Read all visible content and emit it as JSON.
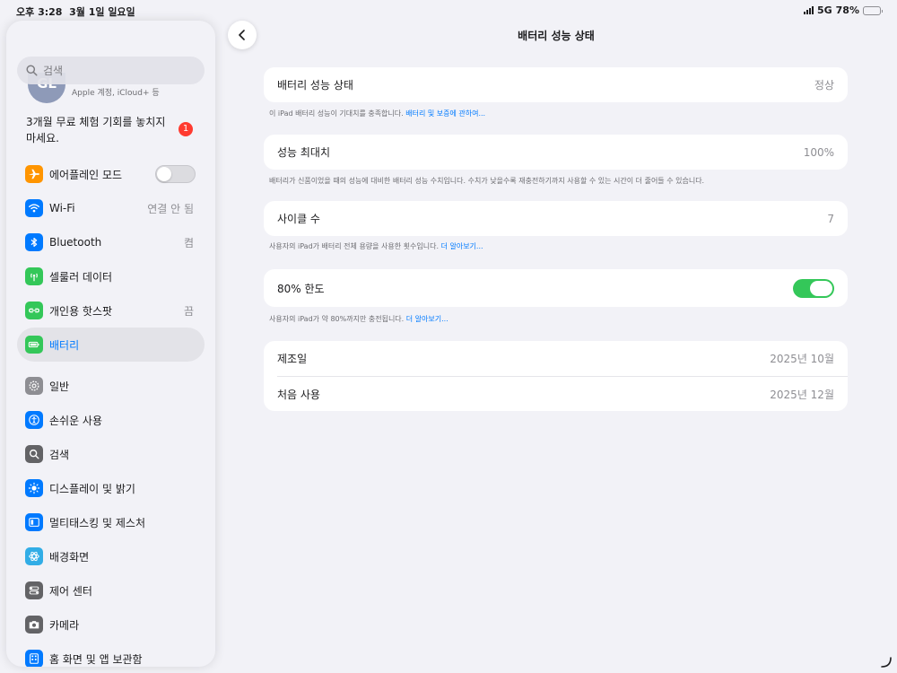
{
  "status": {
    "time": "오후 3:28",
    "date": "3월 1일 일요일",
    "network": "5G",
    "battery_percent": "78%",
    "battery_level": 0.78
  },
  "sidebar": {
    "search_placeholder": "검색",
    "profile": {
      "initials": "GL",
      "subtitle": "Apple 계정, iCloud+ 등"
    },
    "promo": {
      "text": "3개월 무료 체험 기회를 놓치지 마세요.",
      "badge": "1"
    },
    "items": [
      {
        "label": "에어플레인 모드",
        "icon": "airplane-icon",
        "color": "#ff9500",
        "value": ""
      },
      {
        "label": "Wi-Fi",
        "icon": "wifi-icon",
        "color": "#007aff",
        "value": "연결 안 됨"
      },
      {
        "label": "Bluetooth",
        "icon": "bluetooth-icon",
        "color": "#007aff",
        "value": "켬"
      },
      {
        "label": "셀룰러 데이터",
        "icon": "cellular-icon",
        "color": "#34c759",
        "value": ""
      },
      {
        "label": "개인용 핫스팟",
        "icon": "hotspot-icon",
        "color": "#34c759",
        "value": "끔"
      },
      {
        "label": "배터리",
        "icon": "battery-icon",
        "color": "#34c759",
        "value": ""
      },
      {
        "label": "일반",
        "icon": "gear-icon",
        "color": "#8e8e93",
        "value": ""
      },
      {
        "label": "손쉬운 사용",
        "icon": "accessibility-icon",
        "color": "#007aff",
        "value": ""
      },
      {
        "label": "검색",
        "icon": "search-icon",
        "color": "#8e8e93",
        "value": ""
      },
      {
        "label": "디스플레이 및 밝기",
        "icon": "brightness-icon",
        "color": "#007aff",
        "value": ""
      },
      {
        "label": "멀티태스킹 및 제스처",
        "icon": "multitasking-icon",
        "color": "#007aff",
        "value": ""
      },
      {
        "label": "배경화면",
        "icon": "wallpaper-icon",
        "color": "#32ade6",
        "value": ""
      },
      {
        "label": "제어 센터",
        "icon": "control-center-icon",
        "color": "#8e8e93",
        "value": ""
      },
      {
        "label": "카메라",
        "icon": "camera-icon",
        "color": "#8e8e93",
        "value": ""
      },
      {
        "label": "홈 화면 및 앱 보관함",
        "icon": "home-screen-icon",
        "color": "#007aff",
        "value": ""
      }
    ]
  },
  "detail": {
    "title": "배터리 성능 상태",
    "health": {
      "label": "배터리 성능 상태",
      "value": "정상"
    },
    "health_note": "이 iPad 배터리 성능이 기대치를 충족합니다.",
    "health_link": "배터리 및 보증에 관하여...",
    "max_capacity": {
      "label": "성능 최대치",
      "value": "100%"
    },
    "max_capacity_note": "배터리가 신품이었을 때의 성능에 대비한 배터리 성능 수치입니다. 수치가 낮을수록 재충전하기까지 사용할 수 있는 시간이 더 줄어들 수 있습니다.",
    "cycle_count": {
      "label": "사이클 수",
      "value": "7"
    },
    "cycle_note": "사용자의 iPad가 배터리 전체 용량을 사용한 횟수입니다.",
    "cycle_link": "더 알아보기...",
    "limit": {
      "label": "80% 한도",
      "enabled": true
    },
    "limit_note": "사용자의 iPad가 약 80%까지만 충전됩니다.",
    "limit_link": "더 알아보기...",
    "manufacture": {
      "label": "제조일",
      "value": "2025년 10월"
    },
    "first_use": {
      "label": "처음 사용",
      "value": "2025년 12월"
    }
  }
}
